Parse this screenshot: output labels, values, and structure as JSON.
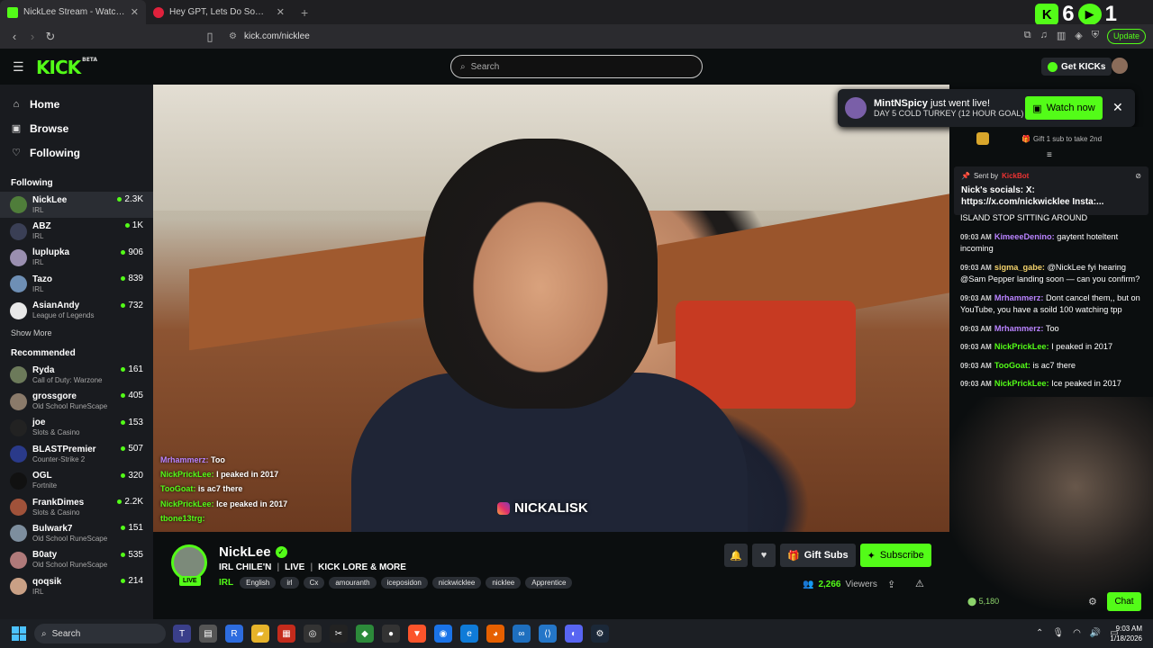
{
  "browser": {
    "tabs": [
      {
        "title": "NickLee Stream - Watch Live",
        "active": true
      },
      {
        "title": "Hey GPT, Lets Do Some Riddles - Yo",
        "active": false
      }
    ],
    "new_tab": "+",
    "url": "kick.com/nicklee",
    "update_label": "Update",
    "overlay_count_a": "6",
    "overlay_count_b": "1"
  },
  "header": {
    "logo": "KICK",
    "logo_badge": "BETA",
    "search_placeholder": "Search",
    "get_kicks": "Get KICKs"
  },
  "sidebar": {
    "nav": [
      {
        "label": "Home",
        "icon": "home-icon"
      },
      {
        "label": "Browse",
        "icon": "browse-icon"
      },
      {
        "label": "Following",
        "icon": "heart-icon"
      }
    ],
    "following_title": "Following",
    "following": [
      {
        "name": "NickLee",
        "category": "IRL",
        "viewers": "2.3K",
        "color": "#4f7d3a"
      },
      {
        "name": "ABZ",
        "category": "IRL",
        "viewers": "1K",
        "color": "#3a3f55"
      },
      {
        "name": "luplupka",
        "category": "IRL",
        "viewers": "906",
        "color": "#9a8fb0"
      },
      {
        "name": "Tazo",
        "category": "IRL",
        "viewers": "839",
        "color": "#6e8fb5"
      },
      {
        "name": "AsianAndy",
        "category": "League of Legends",
        "viewers": "732",
        "color": "#e8e8e8"
      }
    ],
    "show_more": "Show More",
    "recommended_title": "Recommended",
    "recommended": [
      {
        "name": "Ryda",
        "category": "Call of Duty: Warzone",
        "viewers": "161",
        "color": "#6c7a5a"
      },
      {
        "name": "grossgore",
        "category": "Old School RuneScape",
        "viewers": "405",
        "color": "#8a7a6a"
      },
      {
        "name": "joe",
        "category": "Slots & Casino",
        "viewers": "153",
        "color": "#222222"
      },
      {
        "name": "BLASTPremier",
        "category": "Counter-Strike 2",
        "viewers": "507",
        "color": "#2a3a8a"
      },
      {
        "name": "OGL",
        "category": "Fortnite",
        "viewers": "320",
        "color": "#111111"
      },
      {
        "name": "FrankDimes",
        "category": "Slots & Casino",
        "viewers": "2.2K",
        "color": "#a0523a"
      },
      {
        "name": "Bulwark7",
        "category": "Old School RuneScape",
        "viewers": "151",
        "color": "#7d8e9e"
      },
      {
        "name": "B0aty",
        "category": "Old School RuneScape",
        "viewers": "535",
        "color": "#b07a7a"
      },
      {
        "name": "qoqsik",
        "category": "IRL",
        "viewers": "214",
        "color": "#c9a085"
      }
    ]
  },
  "video": {
    "overlay_chat": [
      {
        "user": "Mrhammerz:",
        "text": "Too",
        "purple": true
      },
      {
        "user": "NickPrickLee:",
        "text": "I peaked in 2017",
        "purple": false
      },
      {
        "user": "TooGoat:",
        "text": "is ac7 there",
        "purple": false
      },
      {
        "user": "NickPrickLee:",
        "text": "Ice peaked in 2017",
        "purple": false
      },
      {
        "user": "tbone13trg:",
        "text": "",
        "purple": false
      }
    ],
    "instagram_tag": "NICKALISK"
  },
  "notification": {
    "streamer": "MintNSpicy",
    "suffix": "just went live!",
    "title": "DAY 5 COLD TURKEY (12 HOUR GOAL)",
    "watch_label": "Watch now"
  },
  "chat": {
    "top_gift": "Gift 1 sub to take 2nd",
    "pinned_sent_by": "Sent by",
    "pinned_sender": "KickBot",
    "pinned_message": "Nick's socials: X: https://x.com/nickwicklee Insta:...",
    "messages": [
      {
        "time": "",
        "user": "",
        "text": "ISLAND STOP SITTING AROUND",
        "color": "#ffffff"
      },
      {
        "time": "09:03 AM",
        "user": "KimeeeDenino:",
        "text": "gaytent hoteltent incoming",
        "color": "#b983ff"
      },
      {
        "time": "09:03 AM",
        "user": "sigma_gabe:",
        "text": "@NickLee fyi hearing @Sam Pepper landing soon — can you confirm? ",
        "color": "#f2d16b"
      },
      {
        "time": "09:03 AM",
        "user": "Mrhammerz:",
        "text": "Dont cancel them,, but on YouTube, you have a soild 100 watching tpp",
        "color": "#b983ff"
      },
      {
        "time": "09:03 AM",
        "user": "Mrhammerz:",
        "text": "Too",
        "color": "#b983ff"
      },
      {
        "time": "09:03 AM",
        "user": "NickPrickLee:",
        "text": "I peaked in 2017",
        "color": "#53fc18"
      },
      {
        "time": "09:03 AM",
        "user": "TooGoat:",
        "text": "is ac7 there",
        "color": "#53fc18"
      },
      {
        "time": "09:03 AM",
        "user": "NickPrickLee:",
        "text": "Ice peaked in 2017",
        "color": "#53fc18"
      }
    ],
    "kicks_count": "5,180",
    "chat_button": "Chat"
  },
  "channel": {
    "name": "NickLee",
    "live_label": "LIVE",
    "title_parts": [
      "IRL CHILE'N",
      "LIVE",
      "KICK LORE & MORE"
    ],
    "category": "IRL",
    "tags": [
      "English",
      "irl",
      "Cx",
      "amouranth",
      "iceposidon",
      "nickwicklee",
      "nicklee",
      "Apprentice"
    ],
    "gift_subs": "Gift Subs",
    "subscribe": "Subscribe",
    "viewers": "2,266",
    "viewers_label": "Viewers"
  },
  "taskbar": {
    "search_label": "Search",
    "time": "9:03 AM",
    "date": "1/18/2026"
  },
  "colors": {
    "accent": "#53fc18",
    "background": "#0b0e0f",
    "sidebar": "#191b1f"
  }
}
